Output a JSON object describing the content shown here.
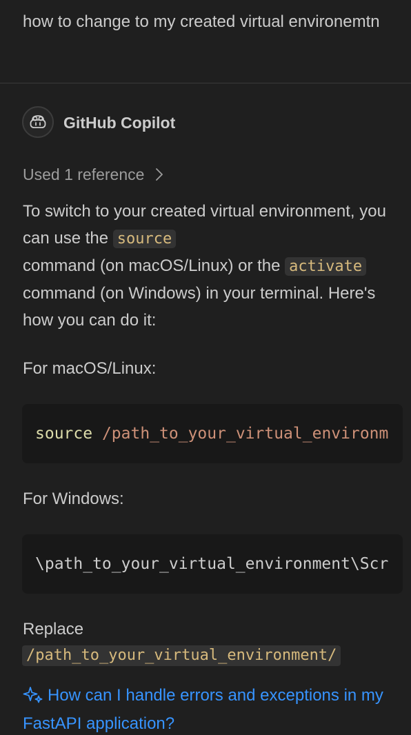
{
  "user_message": "how to change to my created virtual environemtn",
  "assistant": {
    "name": "GitHub Copilot",
    "avatar_icon": "copilot-icon",
    "references_label": "Used 1 reference",
    "intro": {
      "p1": "To switch to your created virtual environment, you can use the ",
      "code1": "source",
      "p2": " command (on macOS/Linux) or the ",
      "code2": "activate",
      "p3": " command (on Windows) in your terminal. Here's how you can do it:"
    },
    "mac_label": "For macOS/Linux:",
    "mac_code": {
      "keyword": "source",
      "path": "/path_to_your_virtual_environm"
    },
    "win_label": "For Windows:",
    "win_code": "\\path_to_your_virtual_environment\\Scr",
    "replace_label": "Replace",
    "replace_code": "/path_to_your_virtual_environment/"
  },
  "suggestion": {
    "icon": "sparkle-icon",
    "text": "How can I handle errors and exceptions in my FastAPI application?"
  },
  "colors": {
    "background": "#1f1f1f",
    "text": "#cccccc",
    "muted": "#9d9d9d",
    "link": "#3794ff",
    "inline_code": "#d7ba7d",
    "code_keyword": "#dcdcaa",
    "code_string": "#ce9178"
  }
}
